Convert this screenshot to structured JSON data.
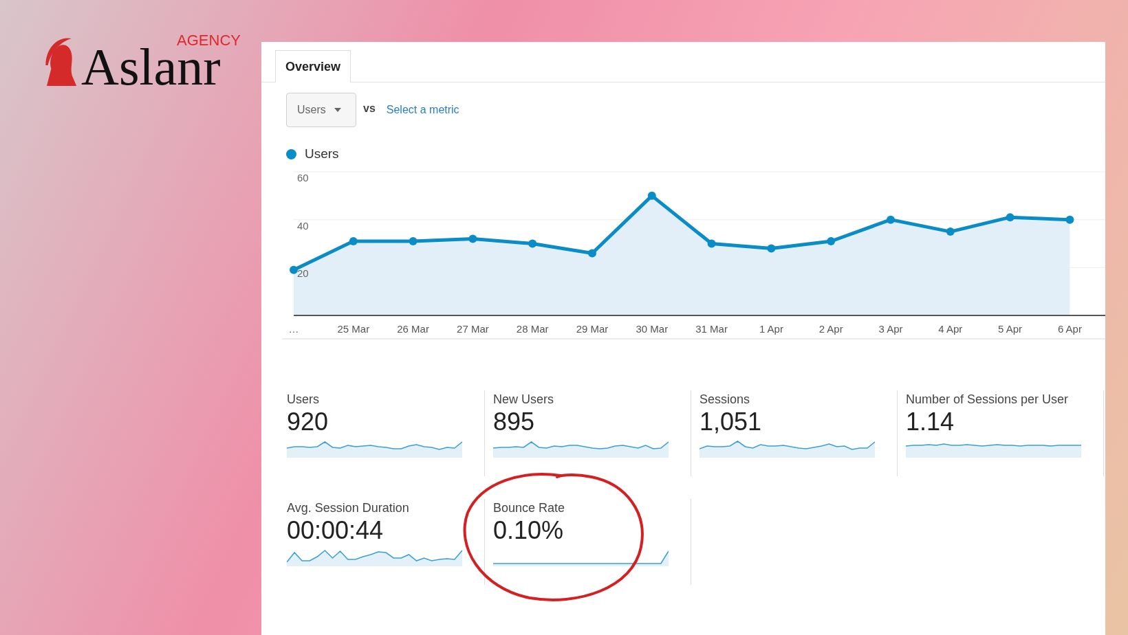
{
  "logo": {
    "tagline": "AGENCY",
    "name": "Aslanr"
  },
  "tabs": [
    {
      "label": "Overview",
      "selected": true
    }
  ],
  "metric_picker": {
    "value": "Users",
    "vs": "vs",
    "link": "Select a metric"
  },
  "chart_data": {
    "type": "area",
    "categories": [
      "…",
      "25 Mar",
      "26 Mar",
      "27 Mar",
      "28 Mar",
      "29 Mar",
      "30 Mar",
      "31 Mar",
      "1 Apr",
      "2 Apr",
      "3 Apr",
      "4 Apr",
      "5 Apr",
      "6 Apr"
    ],
    "ylim": [
      0,
      60
    ],
    "yticks": [
      20,
      40,
      60
    ],
    "series": [
      {
        "name": "Users",
        "color": "#0a8cc6",
        "values": [
          19,
          31,
          31,
          32,
          30,
          26,
          50,
          30,
          28,
          31,
          40,
          35,
          41,
          40
        ]
      }
    ]
  },
  "metrics": [
    {
      "label": "Users",
      "value": "920",
      "circled": false
    },
    {
      "label": "New Users",
      "value": "895",
      "circled": false
    },
    {
      "label": "Sessions",
      "value": "1,051",
      "circled": false
    },
    {
      "label": "Number of Sessions per User",
      "value": "1.14",
      "circled": false
    },
    {
      "label": "Avg. Session Duration",
      "value": "00:00:44",
      "circled": false
    },
    {
      "label": "Bounce Rate",
      "value": "0.10%",
      "circled": true
    }
  ]
}
